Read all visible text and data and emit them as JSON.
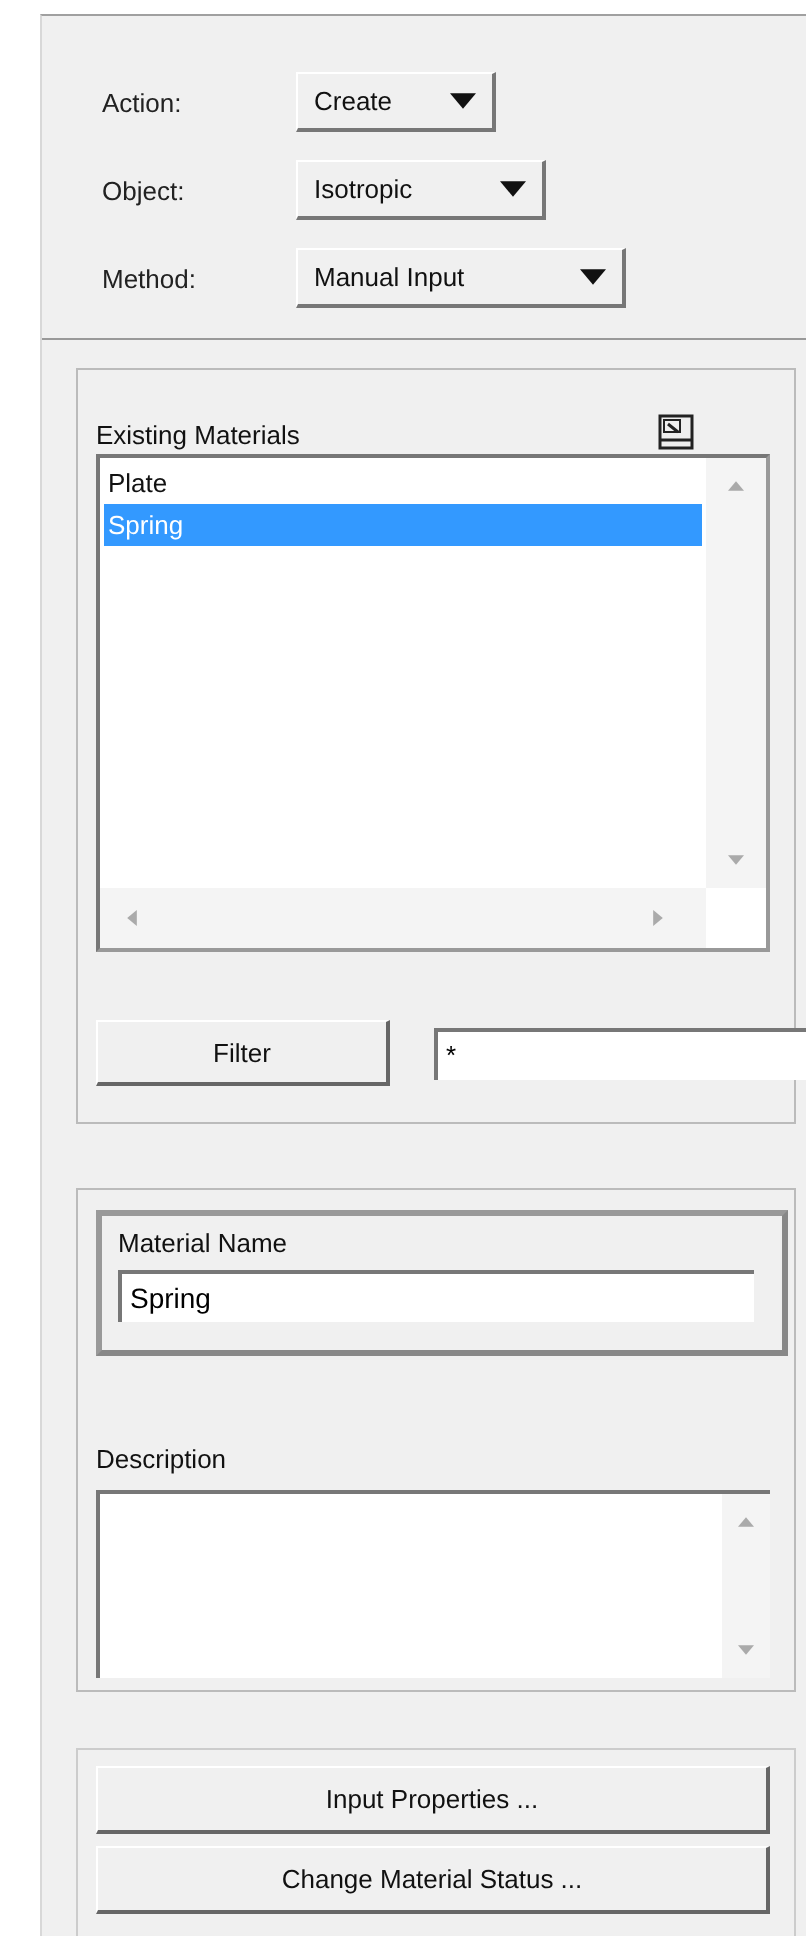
{
  "selectors": [
    {
      "label": "Action:",
      "value": "Create"
    },
    {
      "label": "Object:",
      "value": "Isotropic"
    },
    {
      "label": "Method:",
      "value": "Manual Input"
    }
  ],
  "existing_materials": {
    "label": "Existing Materials",
    "items": [
      {
        "name": "Plate",
        "selected": false
      },
      {
        "name": "Spring",
        "selected": true
      }
    ]
  },
  "filter": {
    "button": "Filter",
    "value": "*"
  },
  "material_name": {
    "label": "Material Name",
    "value": "Spring"
  },
  "description": {
    "label": "Description"
  },
  "buttons": [
    "Input Properties ...",
    "Change Material Status ..."
  ]
}
